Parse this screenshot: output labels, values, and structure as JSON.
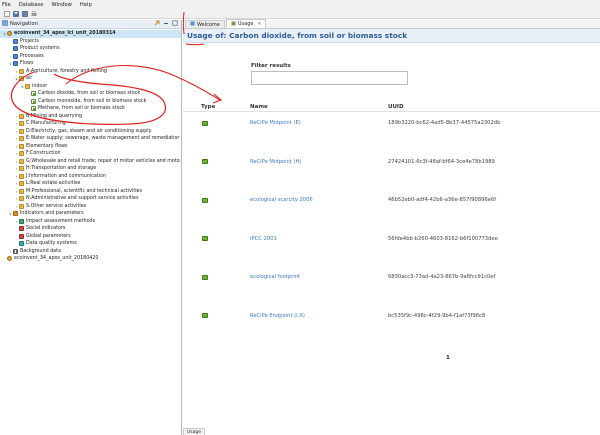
{
  "menu": [
    "File",
    "Database",
    "Window",
    "Help"
  ],
  "navigation": {
    "title": "Navigation",
    "tree": [
      {
        "label": "ecoinvent_34_apos_lci_unit_20180314",
        "level": 0,
        "icon": "db-ic",
        "toggle": "v",
        "bold": true,
        "selected": true
      },
      {
        "label": "Projects",
        "level": 1,
        "icon": "fold-blue",
        "toggle": ""
      },
      {
        "label": "Product systems",
        "level": 1,
        "icon": "fold-blue",
        "toggle": ""
      },
      {
        "label": "Processes",
        "level": 1,
        "icon": "fold-blue",
        "toggle": ">"
      },
      {
        "label": "Flows",
        "level": 1,
        "icon": "fold-blue",
        "toggle": "v"
      },
      {
        "label": "A:Agriculture, forestry and fishing",
        "level": 2,
        "icon": "folder",
        "toggle": ">"
      },
      {
        "label": "air",
        "level": 2,
        "icon": "folder",
        "toggle": "v"
      },
      {
        "label": "indoor",
        "level": 3,
        "icon": "folder",
        "toggle": "v"
      },
      {
        "label": "Carbon dioxide, from soil or biomass stock",
        "level": 4,
        "icon": "flow-ic",
        "toggle": ""
      },
      {
        "label": "Carbon monoxide, from soil or biomass stock",
        "level": 4,
        "icon": "flow-ic",
        "toggle": ""
      },
      {
        "label": "Methane, from soil or biomass stock",
        "level": 4,
        "icon": "flow-ic",
        "toggle": ""
      },
      {
        "label": "B:Mining and quarrying",
        "level": 2,
        "icon": "folder",
        "toggle": ">"
      },
      {
        "label": "C:Manufacturing",
        "level": 2,
        "icon": "folder",
        "toggle": ">"
      },
      {
        "label": "D:Electricity, gas, steam and air conditioning supply",
        "level": 2,
        "icon": "folder",
        "toggle": ">"
      },
      {
        "label": "E:Water supply; sewerage, waste management and remediatior",
        "level": 2,
        "icon": "folder",
        "toggle": ">"
      },
      {
        "label": "Elementary flows",
        "level": 2,
        "icon": "folder",
        "toggle": ">"
      },
      {
        "label": "F:Construction",
        "level": 2,
        "icon": "folder",
        "toggle": ">"
      },
      {
        "label": "G:Wholesale and retail trade; repair of motor vehicles and moto",
        "level": 2,
        "icon": "folder",
        "toggle": ">"
      },
      {
        "label": "H:Transportation and storage",
        "level": 2,
        "icon": "folder",
        "toggle": ">"
      },
      {
        "label": "J:Information and communication",
        "level": 2,
        "icon": "folder",
        "toggle": ">"
      },
      {
        "label": "L:Real estate activities",
        "level": 2,
        "icon": "folder",
        "toggle": ">"
      },
      {
        "label": "M:Professional, scientific and technical activities",
        "level": 2,
        "icon": "folder",
        "toggle": ">"
      },
      {
        "label": "N:Administrative and support service activities",
        "level": 2,
        "icon": "folder",
        "toggle": ">"
      },
      {
        "label": "S:Other service activities",
        "level": 2,
        "icon": "folder",
        "toggle": ">"
      },
      {
        "label": "Indicators and parameters",
        "level": 1,
        "icon": "fold-orange",
        "toggle": "v"
      },
      {
        "label": "Impact assessment methods",
        "level": 2,
        "icon": "fold-green",
        "toggle": ">"
      },
      {
        "label": "Social indicators",
        "level": 2,
        "icon": "fold-red",
        "toggle": ""
      },
      {
        "label": "Global parameters",
        "level": 2,
        "icon": "fold-red",
        "toggle": ""
      },
      {
        "label": "Data quality systems",
        "level": 2,
        "icon": "fold-teal",
        "toggle": ""
      },
      {
        "label": "Background data",
        "level": 1,
        "icon": "grid-ic",
        "toggle": ">"
      },
      {
        "label": "ecoinvent_34_apos_unit_20180420",
        "level": 0,
        "icon": "db-ic",
        "toggle": ""
      }
    ]
  },
  "editor": {
    "tabs": [
      {
        "label": "Welcome",
        "active": false
      },
      {
        "label": "Usage",
        "active": true
      }
    ],
    "header": "Usage of: Carbon dioxide, from soil or biomass stock",
    "filter_label": "Filter results",
    "columns": [
      "Type",
      "Name",
      "UUID"
    ],
    "rows": [
      {
        "name": "ReCiPe Midpoint (E)",
        "uuid": "189b3220-bc62-4ad5-8b37-44575a2302db"
      },
      {
        "name": "ReCiPe Midpoint (H)",
        "uuid": "27424101-6c3f-48af-bf64-3ce4e78b1989"
      },
      {
        "name": "ecological scarcity 2006",
        "uuid": "46b52eb0-adf4-42b6-a36e-857f90896e6f"
      },
      {
        "name": "IPCC 2001",
        "uuid": "56fde4bb-b260-4603-8162-b6f100773dee"
      },
      {
        "name": "ecological footprint",
        "uuid": "6830acc3-73ad-4a23-867b-9a8fcc91c0ef"
      },
      {
        "name": "ReCiPe Endpoint (I,A)",
        "uuid": "bc535f9c-498c-4f29-9b4-f1af73f98c8"
      }
    ],
    "page": "1",
    "bottom_tab": "Usage"
  },
  "colors": {
    "annotation": "#e02020",
    "link": "#3e7bc9",
    "header_text": "#2c5b9a"
  }
}
